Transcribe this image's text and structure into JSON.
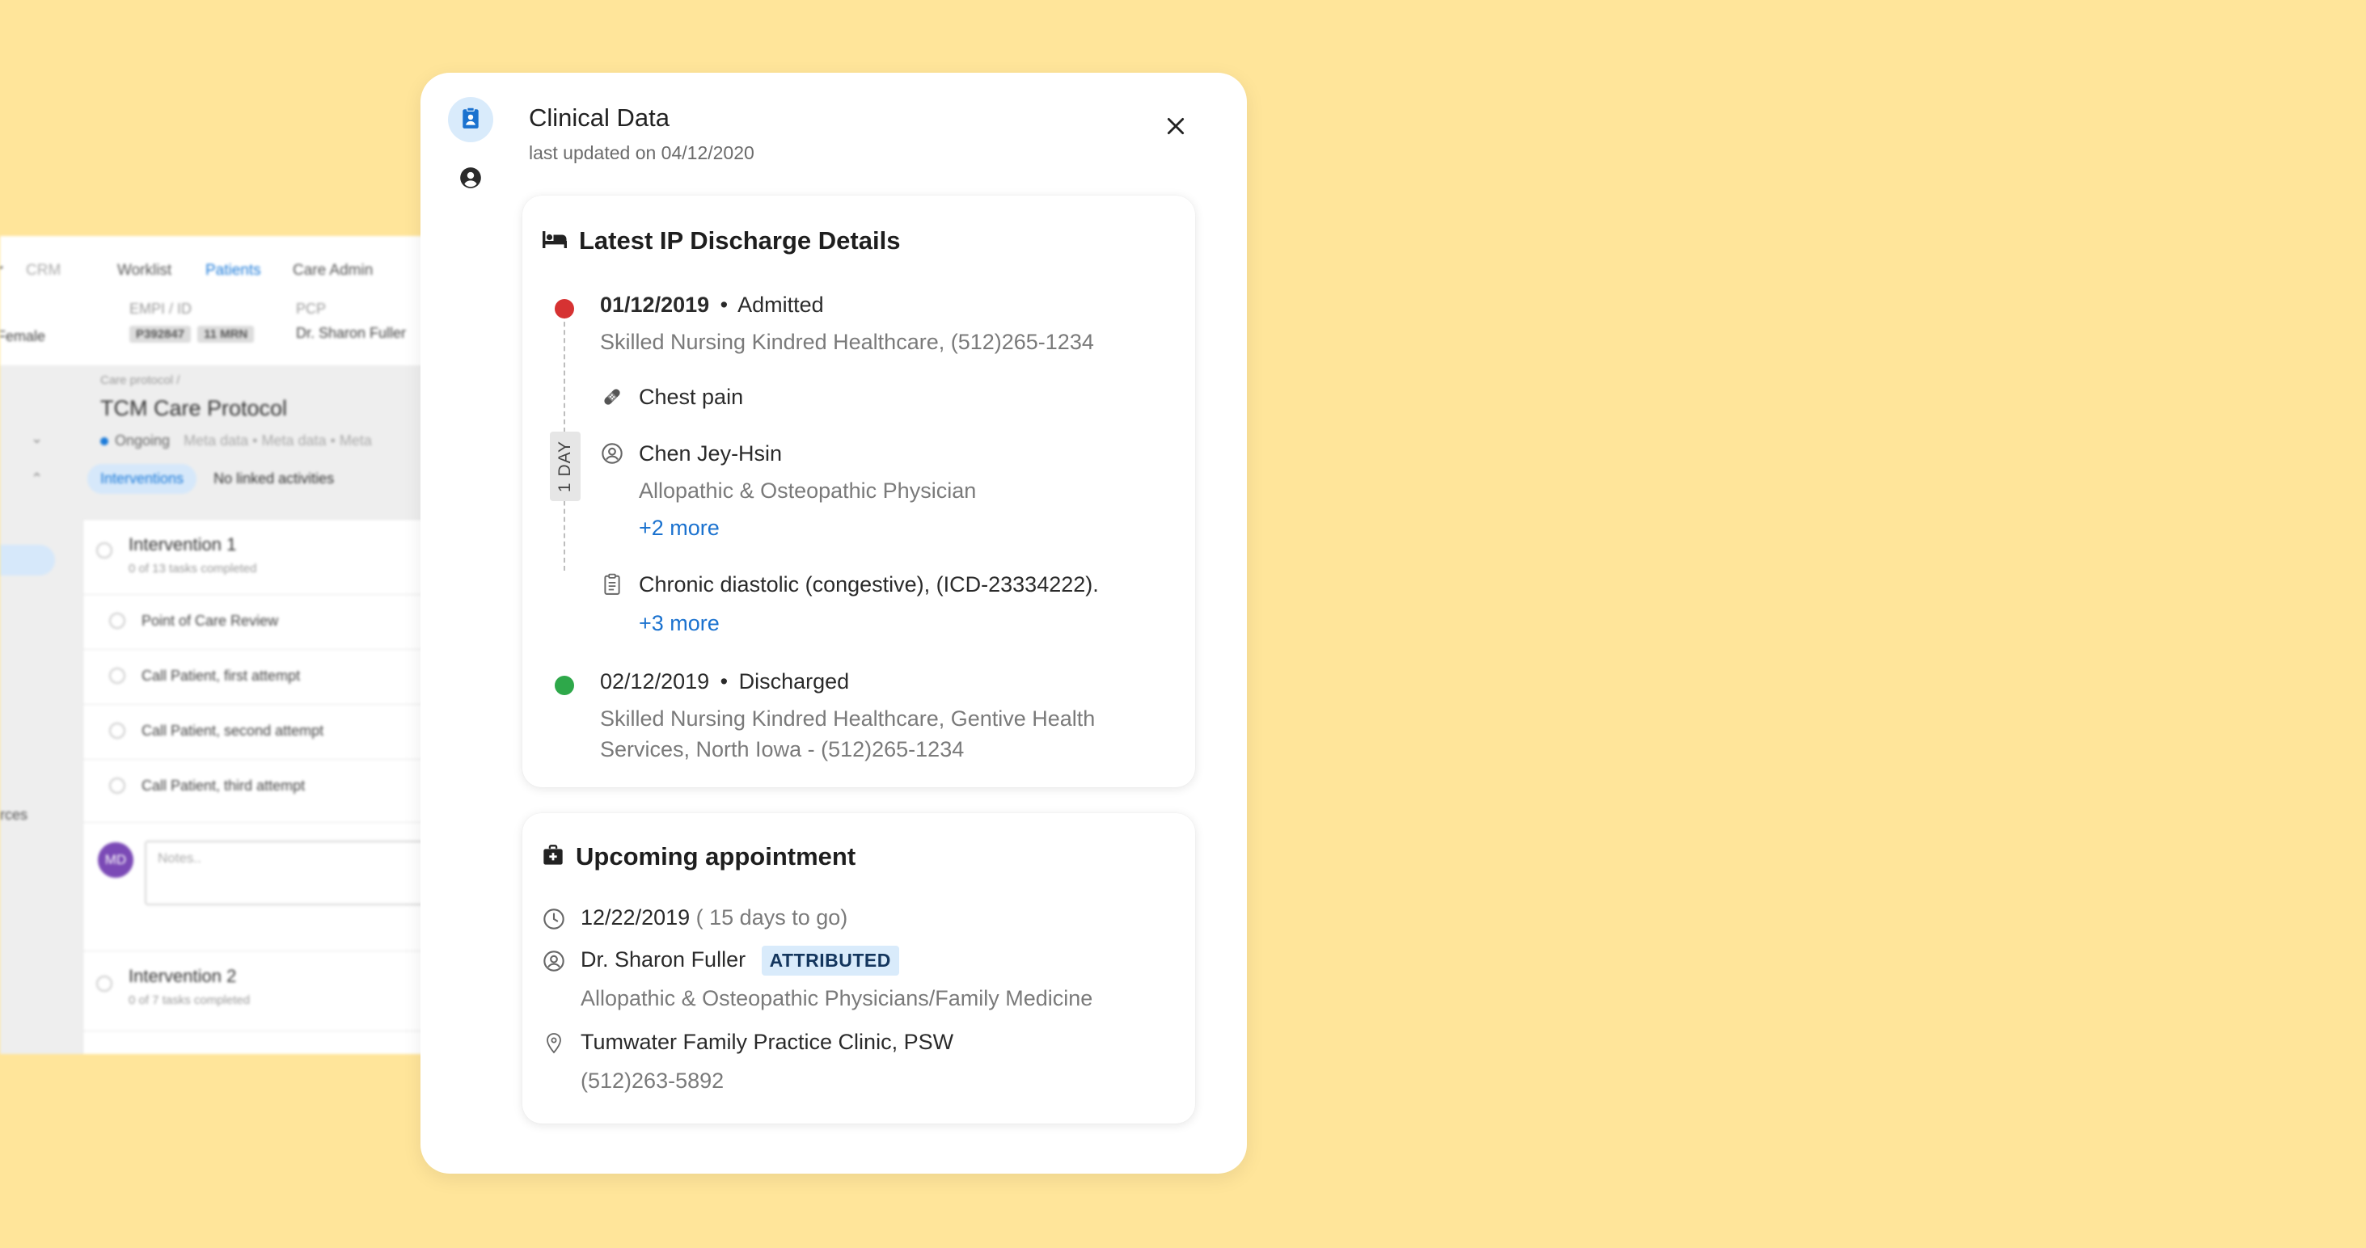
{
  "background_app": {
    "nav": {
      "crm": "CRM",
      "worklist": "Worklist",
      "patients": "Patients",
      "care_admin": "Care Admin"
    },
    "patient": {
      "gender_fragment": "Female",
      "empi_label": "EMPI / ID",
      "empi_value": "P392847",
      "mrn_value": "11 MRN",
      "pcp_label": "PCP",
      "pcp_value": "Dr. Sharon Fuller"
    },
    "breadcrumb": "Care protocol /",
    "protocol_title": "TCM Care Protocol",
    "status": "Ongoing",
    "meta": [
      "Meta data",
      "Meta data",
      "Meta"
    ],
    "tabs": {
      "interventions": "Interventions",
      "no_linked": "No linked activities"
    },
    "side_fragment": "rces",
    "intervention1": {
      "title": "Intervention 1",
      "progress": "0 of 13 tasks completed",
      "tasks": [
        "Point of Care Review",
        "Call Patient, first attempt",
        "Call Patient, second attempt",
        "Call Patient, third attempt"
      ]
    },
    "notes": {
      "avatar": "MD",
      "placeholder": "Notes.."
    },
    "intervention2": {
      "title": "Intervention 2",
      "progress": "0 of 7 tasks completed"
    }
  },
  "modal": {
    "title": "Clinical Data",
    "subtitle": "last updated on 04/12/2020",
    "rail_icons": [
      "clipboard-user-icon",
      "person-circle-icon"
    ],
    "discharge": {
      "title": "Latest IP Discharge Details",
      "admitted": {
        "date": "01/12/2019",
        "bullet": "•",
        "status": "Admitted",
        "facility": "Skilled Nursing Kindred Healthcare, (512)265-1234"
      },
      "duration": "1 DAY",
      "complaint": "Chest pain",
      "provider": {
        "name": "Chen Jey-Hsin",
        "specialty": "Allopathic & Osteopathic Physician",
        "more": "+2 more"
      },
      "diagnosis": {
        "text": "Chronic diastolic (congestive), (ICD-23334222).",
        "more": "+3 more"
      },
      "discharged": {
        "date": "02/12/2019",
        "bullet": "•",
        "status": "Discharged",
        "facility_line1": "Skilled Nursing Kindred Healthcare, Gentive Health",
        "facility_line2": "Services, North Iowa - (512)265-1234"
      },
      "colors": {
        "admitted_dot": "#D63232",
        "discharged_dot": "#2EA84A"
      }
    },
    "appointment": {
      "title": "Upcoming appointment",
      "date": "12/22/2019",
      "relative": "( 15 days  to go)",
      "doctor": "Dr. Sharon Fuller",
      "badge": "ATTRIBUTED",
      "specialty": "Allopathic & Osteopathic Physicians/Family Medicine",
      "location": "Tumwater Family Practice Clinic, PSW",
      "phone": "(512)263-5892"
    }
  }
}
